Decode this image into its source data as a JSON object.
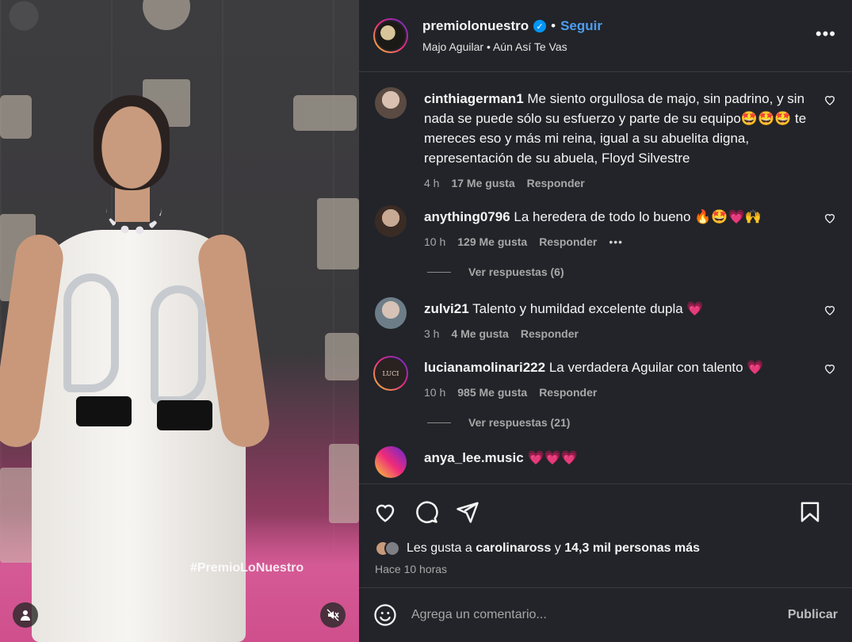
{
  "post": {
    "username": "premiolonuestro",
    "separator": "•",
    "follow_label": "Seguir",
    "audio_artist": "Majo Aguilar",
    "audio_song": "Aún Así Te Vas",
    "audio_sep": "•",
    "more_label": "•••",
    "media_hashtag": "#PremioLoNuestro"
  },
  "comments": [
    {
      "user": "cinthiagerman1",
      "text": "Me siento orgullosa de majo, sin padrino, y sin nada se puede sólo su esfuerzo y parte de su equipo🤩🤩🤩 te mereces eso y más mi reina, igual a su abuelita digna, representación de su abuela, Floyd Silvestre",
      "time": "4 h",
      "likes": "17 Me gusta",
      "reply": "Responder"
    },
    {
      "user": "anything0796",
      "text": "La heredera de todo lo bueno 🔥🤩💗🙌",
      "time": "10 h",
      "likes": "129 Me gusta",
      "reply": "Responder",
      "more": "•••",
      "view_replies": "Ver respuestas (6)"
    },
    {
      "user": "zulvi21",
      "text": "Talento y humildad excelente dupla 💗",
      "time": "3 h",
      "likes": "4 Me gusta",
      "reply": "Responder"
    },
    {
      "user": "lucianamolinari222",
      "text": "La verdadera Aguilar con talento 💗",
      "time": "10 h",
      "likes": "985 Me gusta",
      "reply": "Responder",
      "view_replies": "Ver respuestas (21)"
    },
    {
      "user": "anya_lee.music",
      "text": "💗💗💗"
    }
  ],
  "likes": {
    "prefix": "Les gusta a",
    "user": "carolinaross",
    "connector": "y",
    "others": "14,3 mil personas más"
  },
  "time_ago": "Hace 10 horas",
  "composer": {
    "placeholder": "Agrega un comentario...",
    "publish": "Publicar"
  },
  "icons": [
    "heart-icon",
    "comment-icon",
    "share-icon",
    "bookmark-icon",
    "emoji-icon",
    "verified-icon",
    "more-icon",
    "user-tag-icon",
    "mute-icon"
  ],
  "colors": {
    "panel_bg": "#222429",
    "follow": "#4d9df2",
    "verified": "#0095f6",
    "muted_text": "#a8a8a8"
  }
}
